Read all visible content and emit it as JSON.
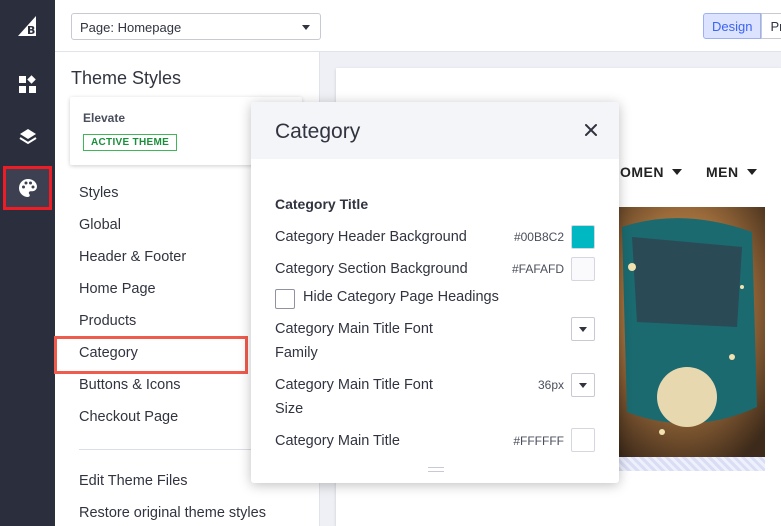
{
  "rail": {
    "items": [
      {
        "icon": "bigcommerce-logo-icon"
      },
      {
        "icon": "widgets-icon"
      },
      {
        "icon": "layers-icon"
      },
      {
        "icon": "palette-icon",
        "active": true
      }
    ]
  },
  "topbar": {
    "page_select": "Page: Homepage",
    "modes": [
      "Design",
      "Pr"
    ]
  },
  "sidebar": {
    "title": "Theme Styles",
    "theme_card": {
      "name": "Elevate",
      "badge": "ACTIVE THEME"
    },
    "items": [
      {
        "label": "Styles"
      },
      {
        "label": "Global"
      },
      {
        "label": "Header & Footer"
      },
      {
        "label": "Home Page"
      },
      {
        "label": "Products"
      },
      {
        "label": "Category"
      },
      {
        "label": "Buttons & Icons"
      },
      {
        "label": "Checkout Page"
      }
    ],
    "footer_items": [
      {
        "label": "Edit Theme Files"
      },
      {
        "label": "Restore original theme styles"
      }
    ]
  },
  "preview": {
    "nav": [
      "OMEN",
      "MEN"
    ]
  },
  "modal": {
    "title": "Category",
    "section_title": "Category Title",
    "rows": {
      "header_bg": {
        "label": "Category Header Background",
        "value": "#00B8C2",
        "color": "#00B8C2"
      },
      "section_bg": {
        "label": "Category Section Background",
        "value": "#FAFAFD",
        "color": "#FAFAFD"
      },
      "hide_headings": {
        "label": "Hide Category Page Headings",
        "checked": false
      },
      "title_font_family": {
        "label": "Category Main Title Font Family"
      },
      "title_font_size": {
        "label": "Category Main Title Font Size",
        "value": "36px"
      },
      "main_title": {
        "label": "Category Main Title",
        "value": "#FFFFFF",
        "color": "#FFFFFF"
      }
    }
  }
}
